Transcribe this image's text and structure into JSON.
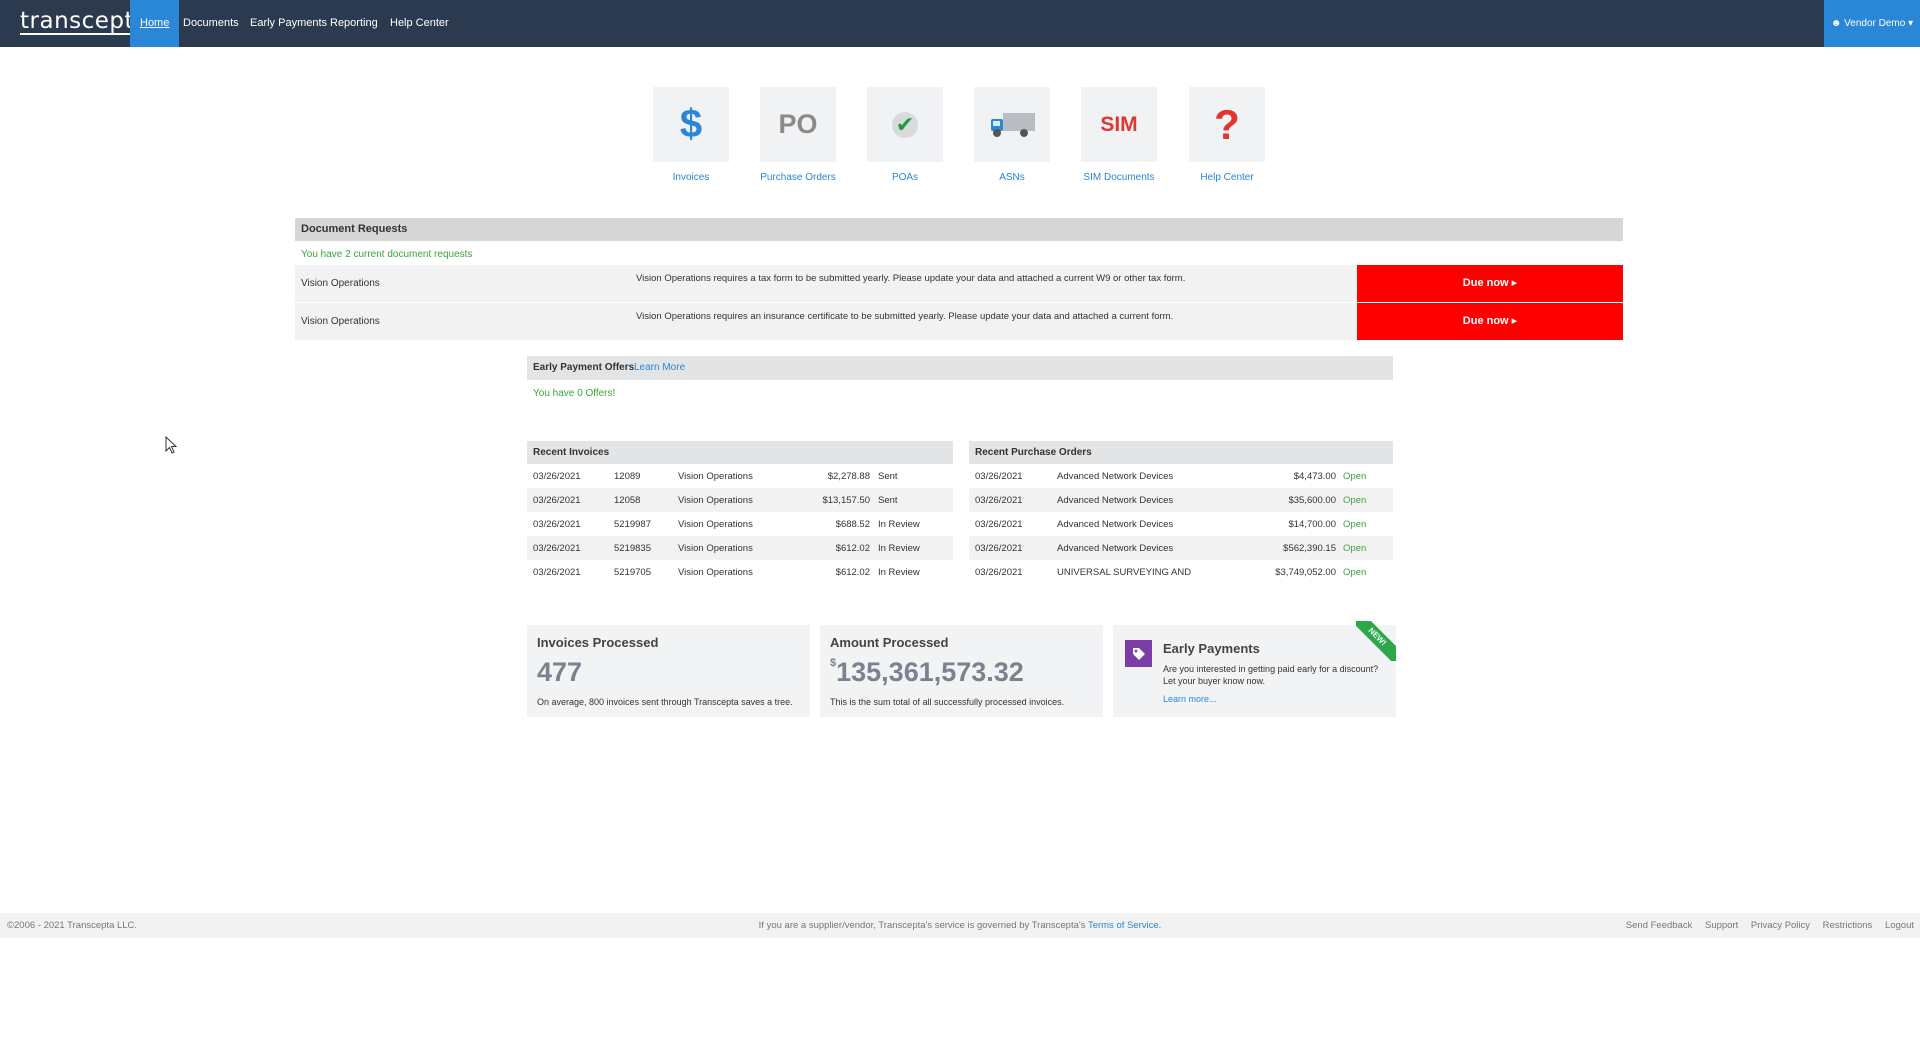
{
  "brand": {
    "logo": "transcepta"
  },
  "nav": {
    "items": [
      {
        "label": "Home",
        "active": true
      },
      {
        "label": "Documents"
      },
      {
        "label": "Early Payments"
      },
      {
        "label": "Reporting"
      },
      {
        "label": "Help Center"
      }
    ],
    "user_menu": "Vendor Demo"
  },
  "tiles": [
    {
      "label": "Invoices",
      "icon": "dollar-icon",
      "glyph": "$"
    },
    {
      "label": "Purchase Orders",
      "icon": "po-icon",
      "glyph": "PO"
    },
    {
      "label": "POAs",
      "icon": "checkmark-icon",
      "glyph": "✔"
    },
    {
      "label": "ASNs",
      "icon": "truck-icon"
    },
    {
      "label": "SIM Documents",
      "icon": "sim-icon",
      "glyph": "SIM"
    },
    {
      "label": "Help Center",
      "icon": "question-icon",
      "glyph": "?"
    }
  ],
  "document_requests": {
    "title": "Document Requests",
    "count_text": "You have 2 current document requests",
    "rows": [
      {
        "requester": "Vision Operations",
        "message": "Vision Operations requires a tax form to be submitted yearly. Please update your data and attached a current W9 or other tax form.",
        "action": "Due now ▸"
      },
      {
        "requester": "Vision Operations",
        "message": "Vision Operations requires an insurance certificate to be submitted yearly. Please update your data and attached a current form.",
        "action": "Due now ▸"
      }
    ]
  },
  "early_payment_offers": {
    "title": "Early Payment Offers",
    "learn_more": "Learn More",
    "count_text": "You have 0 Offers!"
  },
  "recent_invoices": {
    "title": "Recent Invoices",
    "rows": [
      {
        "date": "03/26/2021",
        "number": "12089",
        "customer": "Vision Operations",
        "amount": "$2,278.88",
        "status": "Sent"
      },
      {
        "date": "03/26/2021",
        "number": "12058",
        "customer": "Vision Operations",
        "amount": "$13,157.50",
        "status": "Sent"
      },
      {
        "date": "03/26/2021",
        "number": "5219987",
        "customer": "Vision Operations",
        "amount": "$688.52",
        "status": "In Review"
      },
      {
        "date": "03/26/2021",
        "number": "5219835",
        "customer": "Vision Operations",
        "amount": "$612.02",
        "status": "In Review"
      },
      {
        "date": "03/26/2021",
        "number": "5219705",
        "customer": "Vision Operations",
        "amount": "$612.02",
        "status": "In Review"
      }
    ]
  },
  "recent_purchase_orders": {
    "title": "Recent Purchase Orders",
    "rows": [
      {
        "date": "03/26/2021",
        "customer": "Advanced Network Devices",
        "amount": "$4,473.00",
        "status": "Open"
      },
      {
        "date": "03/26/2021",
        "customer": "Advanced Network Devices",
        "amount": "$35,600.00",
        "status": "Open"
      },
      {
        "date": "03/26/2021",
        "customer": "Advanced Network Devices",
        "amount": "$14,700.00",
        "status": "Open"
      },
      {
        "date": "03/26/2021",
        "customer": "Advanced Network Devices",
        "amount": "$562,390.15",
        "status": "Open"
      },
      {
        "date": "03/26/2021",
        "customer": "UNIVERSAL SURVEYING AND",
        "amount": "$3,749,052.00",
        "status": "Open"
      }
    ]
  },
  "stats": {
    "invoices_processed": {
      "label": "Invoices Processed",
      "value": "477",
      "note": "On average, 800 invoices sent through Transcepta saves a tree."
    },
    "amount_processed": {
      "label": "Amount Processed",
      "currency": "$",
      "value": "135,361,573.32",
      "note": "This is the sum total of all successfully processed invoices."
    },
    "early_payments": {
      "title": "Early Payments",
      "text": "Are you interested in getting paid early for a discount? Let your buyer know now.",
      "link": "Learn more...",
      "badge": "NEW!"
    }
  },
  "footer": {
    "copyright": "©2006 - 2021 Transcepta LLC.",
    "notice": "If you are a supplier/vendor, Transcepta's service is governed by Transcepta's",
    "terms": "Terms of Service.",
    "links": [
      "Send Feedback",
      "Support",
      "Privacy Policy",
      "Restrictions",
      "Logout"
    ]
  },
  "colors": {
    "navbar": "#2c3a4f",
    "accent": "#2a86d6",
    "due": "#ff0000",
    "success": "#3aa53a"
  }
}
